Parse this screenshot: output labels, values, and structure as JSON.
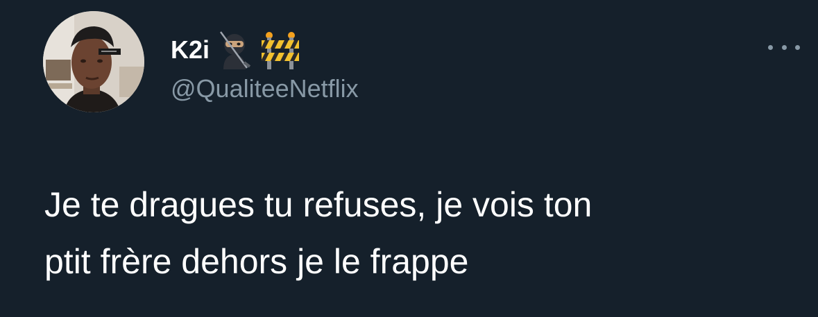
{
  "author": {
    "display_name": "K2i",
    "handle": "@QualiteeNetflix",
    "name_emojis": [
      "ninja-icon",
      "construction-barrier-icon"
    ]
  },
  "tweet": {
    "text": "Je te dragues tu refuses, je vois ton\nptit frère dehors je le frappe"
  },
  "menu": {
    "icon": "more-horizontal-icon"
  },
  "colors": {
    "background": "#15202b",
    "primary_text": "#ffffff",
    "secondary_text": "#8899a6"
  }
}
